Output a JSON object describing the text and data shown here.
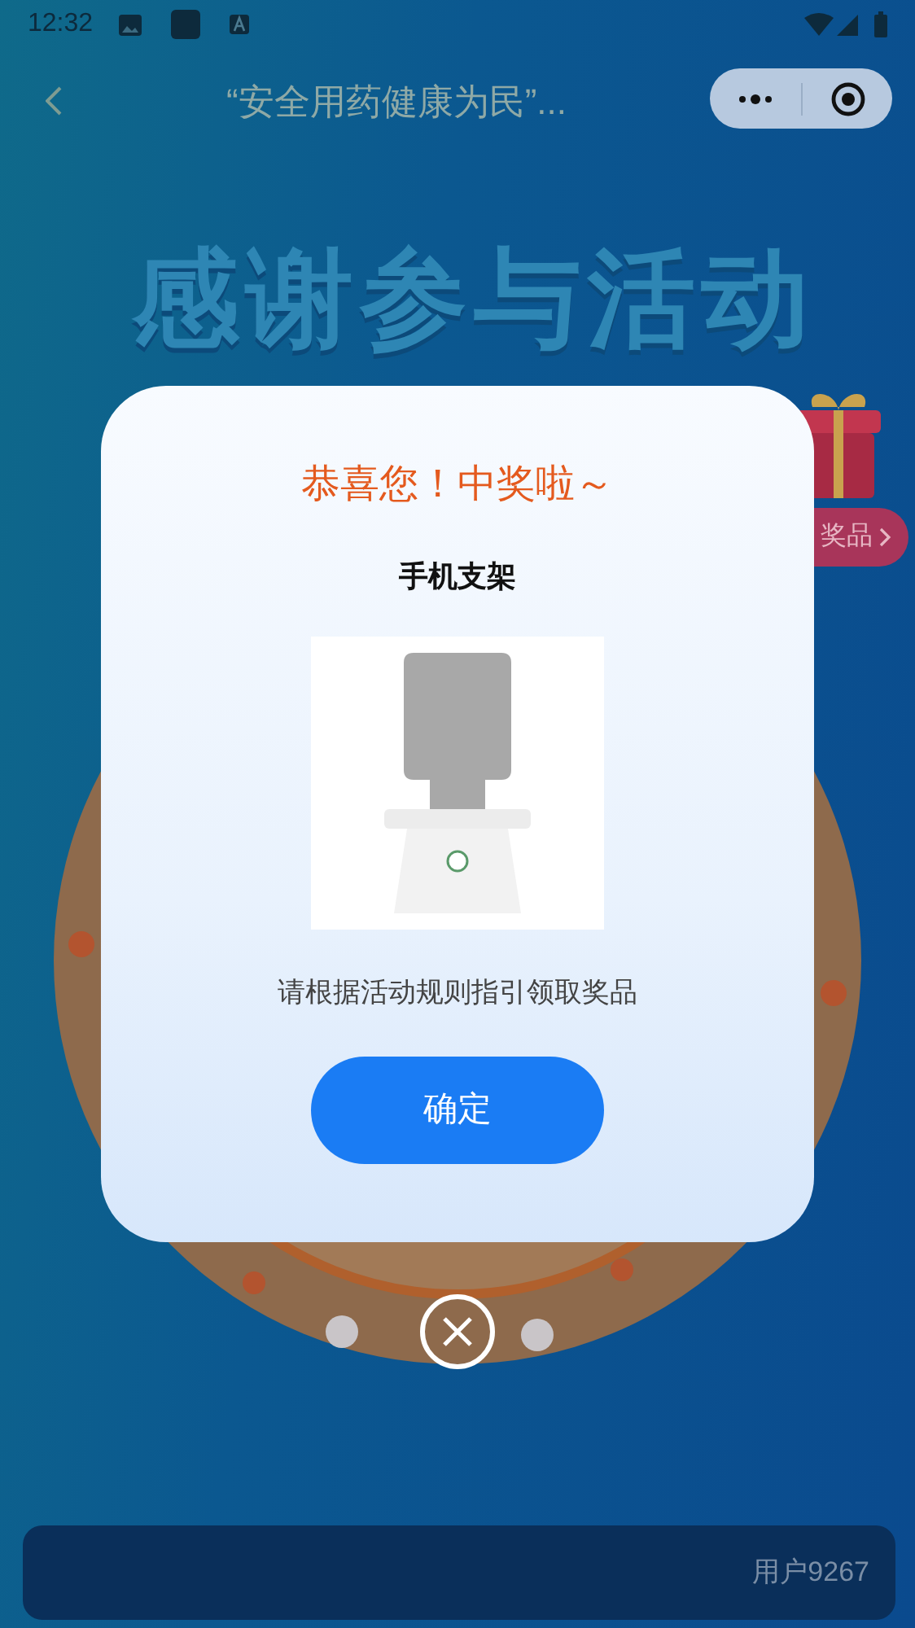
{
  "status_bar": {
    "time": "12:32"
  },
  "nav_bar": {
    "title": "“安全用药健康为民”..."
  },
  "background": {
    "headline": "感谢参与活动",
    "prize_button": "奖品"
  },
  "dialog": {
    "heading": "恭喜您！中奖啦～",
    "prize_name": "手机支架",
    "instruction": "请根据活动规则指引领取奖品",
    "confirm_button": "确定"
  },
  "bottom_bar": {
    "text": "用户9267"
  }
}
